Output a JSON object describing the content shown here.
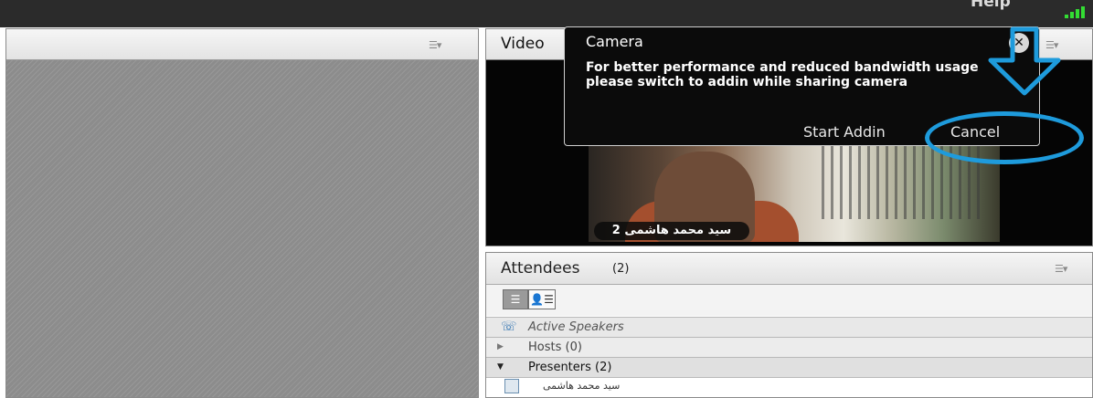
{
  "topbar": {
    "help_label": "Help"
  },
  "left_pod": {
    "menu_icon": "pod-options-icon"
  },
  "video_pod": {
    "title": "Video",
    "menu_icon": "pod-options-icon",
    "participant_name": "سید محمد هاشمی 2"
  },
  "camera_dialog": {
    "title": "Camera",
    "message": "For better performance and reduced bandwidth usage please switch to addin while sharing camera",
    "start_addin_label": "Start Addin",
    "cancel_label": "Cancel",
    "close_icon": "close-icon"
  },
  "annotation": {
    "color": "#1e9bdc"
  },
  "attendees": {
    "title": "Attendees",
    "count": "(2)",
    "active_speakers_label": "Active Speakers",
    "hosts_label": "Hosts (0)",
    "presenters_label": "Presenters (2)",
    "user_name": "سید محمد هاشمی"
  },
  "colors": {
    "signal_green": "#33dd33",
    "badge_bg": "#0a0a0a"
  }
}
